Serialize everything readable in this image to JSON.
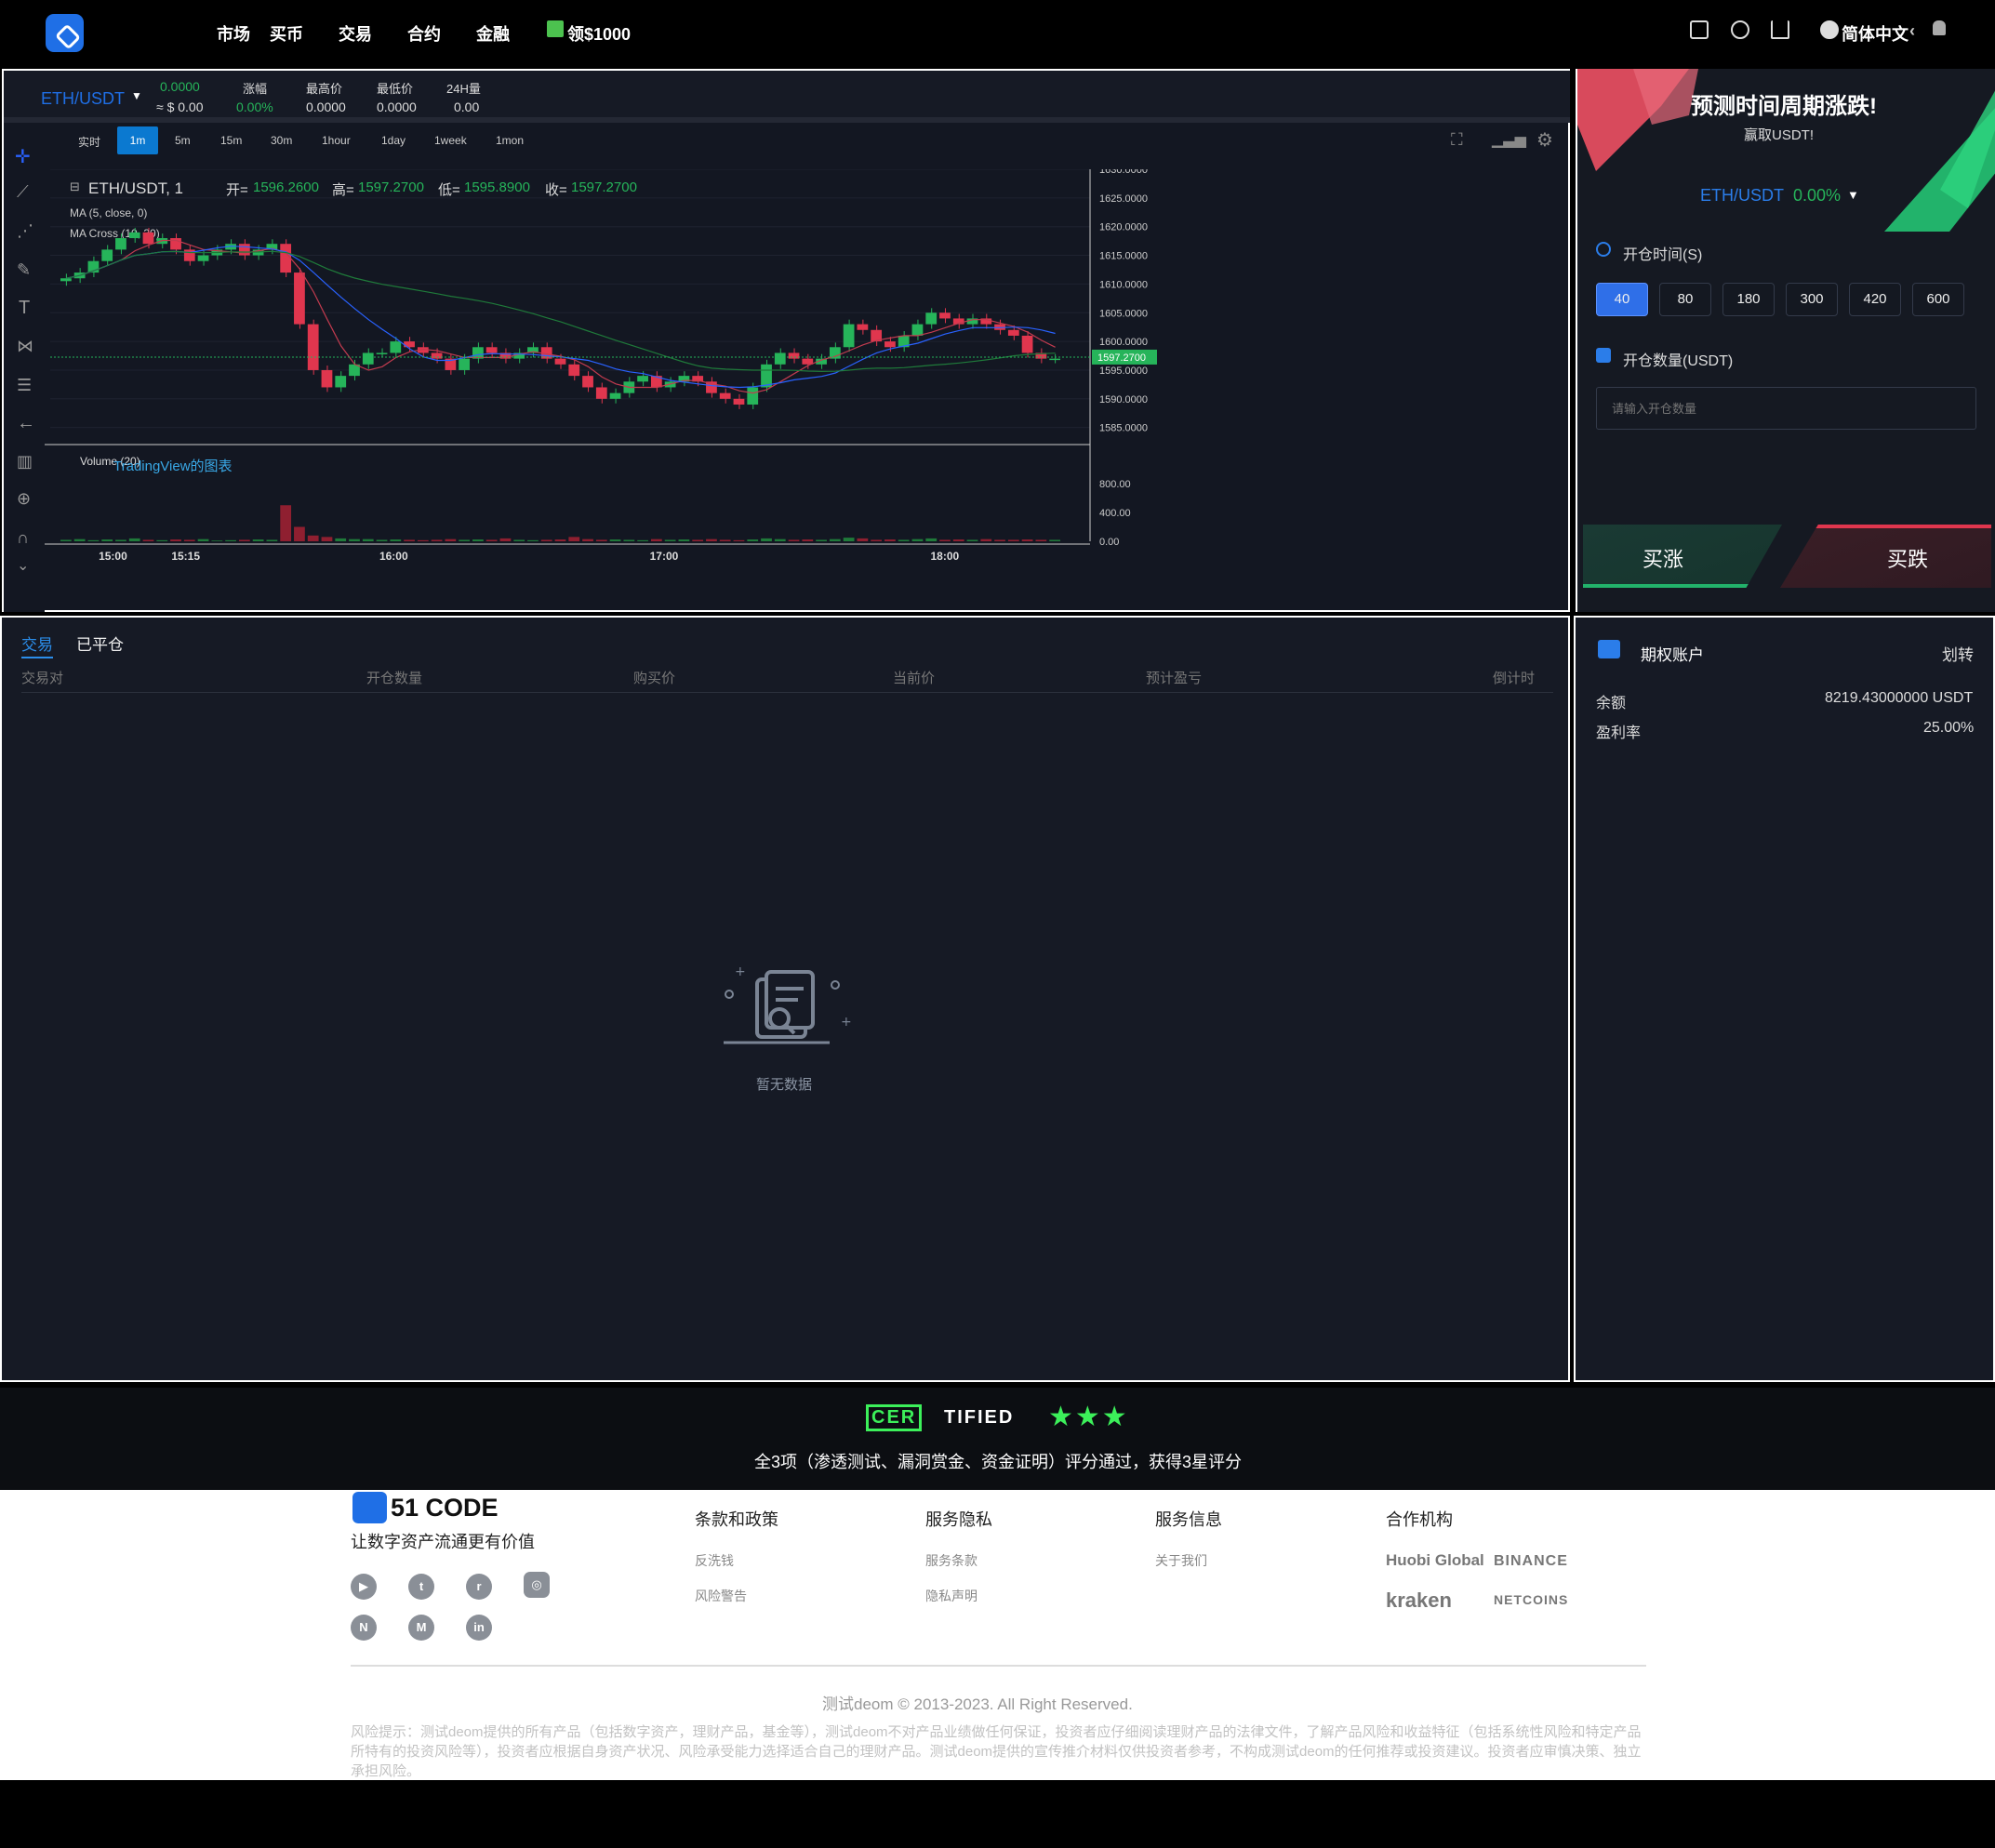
{
  "nav": {
    "items": [
      "市场",
      "买币",
      "交易",
      "合约",
      "金融"
    ],
    "gift": "领$1000",
    "language": "简体中文"
  },
  "ticker": {
    "pair": "ETH/USDT",
    "price": "0.0000",
    "price_usd": "≈ $ 0.00",
    "change_label": "涨幅",
    "change": "0.00%",
    "high_label": "最高价",
    "high": "0.0000",
    "low_label": "最低价",
    "low": "0.0000",
    "vol_label": "24H量",
    "vol": "0.00"
  },
  "timeframes": [
    "实时",
    "1m",
    "5m",
    "15m",
    "30m",
    "1hour",
    "1day",
    "1week",
    "1mon"
  ],
  "active_timeframe": "1m",
  "legend": {
    "symbol": "ETH/USDT, 1",
    "open_label": "开=",
    "open": "1596.2600",
    "high_label": "高=",
    "high": "1597.2700",
    "low_label": "低=",
    "low": "1595.8900",
    "close_label": "收=",
    "close": "1597.2700",
    "ma1": "MA (5, close, 0)",
    "ma2": "MA Cross (10, 30)",
    "volume": "Volume (20)",
    "watermark": "TradingView的图表"
  },
  "chart_data": {
    "type": "candlestick",
    "price_axis_ticks": [
      "1630.0000",
      "1625.0000",
      "1620.0000",
      "1615.0000",
      "1610.0000",
      "1605.0000",
      "1600.0000",
      "1595.0000",
      "1590.0000",
      "1585.0000"
    ],
    "last_price": "1597.2700",
    "volume_axis_ticks": [
      "800.00",
      "400.00",
      "0.00"
    ],
    "time_ticks": [
      "15:00",
      "15:15",
      "16:00",
      "17:00",
      "18:00"
    ],
    "close_series": [
      1611,
      1612,
      1614,
      1616,
      1618,
      1619,
      1617,
      1618,
      1616,
      1614,
      1615,
      1616,
      1617,
      1615,
      1616,
      1617,
      1612,
      1603,
      1595,
      1592,
      1594,
      1596,
      1598,
      1598,
      1600,
      1599,
      1598,
      1597,
      1595,
      1597,
      1599,
      1598,
      1597,
      1598,
      1599,
      1597,
      1596,
      1594,
      1592,
      1590,
      1591,
      1593,
      1594,
      1592,
      1593,
      1594,
      1593,
      1591,
      1590,
      1589,
      1592,
      1596,
      1598,
      1597,
      1596,
      1597,
      1599,
      1603,
      1602,
      1600,
      1599,
      1601,
      1603,
      1605,
      1604,
      1603,
      1604,
      1603,
      1602,
      1601,
      1598,
      1597,
      1597
    ],
    "volume_series": [
      20,
      30,
      15,
      25,
      20,
      40,
      20,
      15,
      25,
      20,
      30,
      10,
      15,
      20,
      25,
      20,
      500,
      200,
      80,
      60,
      40,
      30,
      30,
      20,
      25,
      20,
      15,
      20,
      30,
      20,
      25,
      20,
      40,
      20,
      15,
      20,
      25,
      60,
      30,
      20,
      25,
      20,
      15,
      30,
      20,
      25,
      20,
      30,
      20,
      15,
      25,
      40,
      30,
      20,
      25,
      20,
      30,
      50,
      40,
      20,
      25,
      20,
      30,
      40,
      20,
      25,
      20,
      30,
      20,
      20,
      25,
      20,
      20
    ]
  },
  "promo": {
    "title": "预测时间周期涨跌!",
    "subtitle": "赢取USDT!",
    "pair": "ETH/USDT",
    "change": "0.00%"
  },
  "order": {
    "time_label": "开仓时间(S)",
    "durations": [
      "40",
      "80",
      "180",
      "300",
      "420",
      "600"
    ],
    "qty_label": "开仓数量(USDT)",
    "qty_placeholder": "请输入开仓数量",
    "buy_up": "买涨",
    "buy_down": "买跌"
  },
  "trades": {
    "tabs": [
      "交易",
      "已平仓"
    ],
    "columns": [
      "交易对",
      "开仓数量",
      "购买价",
      "当前价",
      "预计盈亏",
      "倒计时"
    ],
    "empty": "暂无数据"
  },
  "account": {
    "title": "期权账户",
    "transfer": "划转",
    "balance_label": "余额",
    "balance": "8219.43000000 USDT",
    "rate_label": "盈利率",
    "rate": "25.00%"
  },
  "cert": {
    "badge_a": "CER",
    "badge_b": "TIFIED",
    "text": "全3项（渗透测试、漏洞赏金、资金证明）评分通过，获得3星评分"
  },
  "footer": {
    "brand": "51 CODE",
    "slogan": "让数字资产流通更有价值",
    "col1_title": "条款和政策",
    "col1_links": [
      "反洗钱",
      "风险警告"
    ],
    "col2_title": "服务隐私",
    "col2_links": [
      "服务条款",
      "隐私声明"
    ],
    "col3_title": "服务信息",
    "col3_links": [
      "关于我们"
    ],
    "col4_title": "合作机构",
    "partners": [
      "Huobi Global",
      "BINANCE",
      "kraken",
      "NETCOINS"
    ],
    "copyright": "测试deom © 2013-2023. All Right Reserved.",
    "risk": "风险提示：测试deom提供的所有产品（包括数字资产，理财产品，基金等），测试deom不对产品业绩做任何保证，投资者应仔细阅读理财产品的法律文件，了解产品风险和收益特征（包括系统性风险和特定产品所特有的投资风险等），投资者应根据自身资产状况、风险承受能力选择适合自己的理财产品。测试deom提供的宣传推介材料仅供投资者参考，不构成测试deom的任何推荐或投资建议。投资者应审慎决策、独立承担风险。"
  },
  "colors": {
    "up": "#26b45a",
    "down": "#e0364e",
    "accent": "#1f6fe6"
  }
}
